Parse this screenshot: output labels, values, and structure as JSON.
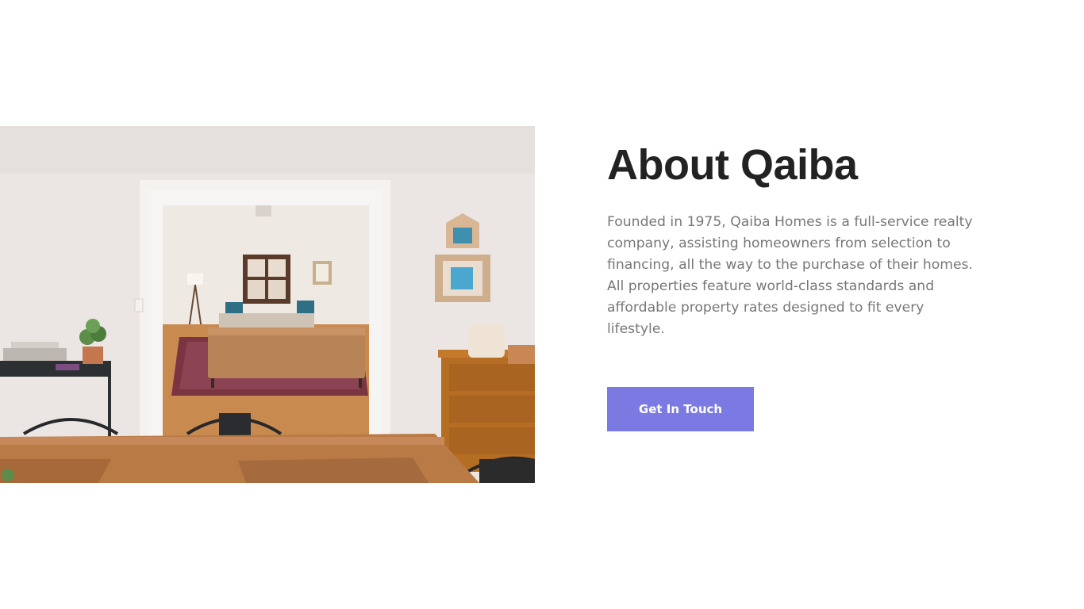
{
  "about": {
    "title": "About Qaiba",
    "description": "Founded in 1975, Qaiba Homes is a full-service realty company, assisting homeowners from selection to financing, all the way to the purchase of their homes. All properties feature world-class standards and affordable property rates designed to fit every lifestyle.",
    "cta_label": "Get In Touch"
  },
  "colors": {
    "accent": "#7a7ae2",
    "title": "#222222",
    "body_text": "#777777",
    "background": "#ffffff"
  }
}
